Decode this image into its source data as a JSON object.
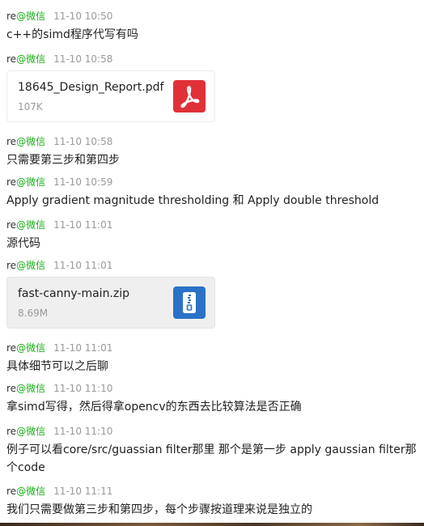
{
  "messages": [
    {
      "sender_name": "re",
      "sender_app": "@微信",
      "time": "11-10 10:50",
      "text": "c++的simd程序代写有吗"
    },
    {
      "sender_name": "re",
      "sender_app": "@微信",
      "time": "11-10 10:58",
      "file": {
        "name": "18645_Design_Report.pdf",
        "size": "107K",
        "icon": "pdf-icon",
        "color": "#e03137"
      }
    },
    {
      "sender_name": "re",
      "sender_app": "@微信",
      "time": "11-10 10:58",
      "text": "只需要第三步和第四步"
    },
    {
      "sender_name": "re",
      "sender_app": "@微信",
      "time": "11-10 10:59",
      "text": "Apply gradient magnitude thresholding 和 Apply double threshold"
    },
    {
      "sender_name": "re",
      "sender_app": "@微信",
      "time": "11-10 11:01",
      "text": "源代码"
    },
    {
      "sender_name": "re",
      "sender_app": "@微信",
      "time": "11-10 11:01",
      "file": {
        "name": "fast-canny-main.zip",
        "size": "8.69M",
        "icon": "zip-icon",
        "color": "#2a72c6"
      }
    },
    {
      "sender_name": "re",
      "sender_app": "@微信",
      "time": "11-10 11:01",
      "text": "具体细节可以之后聊"
    },
    {
      "sender_name": "re",
      "sender_app": "@微信",
      "time": "11-10 11:10",
      "text": "拿simd写得，然后得拿opencv的东西去比较算法是否正确"
    },
    {
      "sender_name": "re",
      "sender_app": "@微信",
      "time": "11-10 11:10",
      "text": "例子可以看core/src/guassian filter那里 那个是第一步 apply gaussian filter那个code"
    },
    {
      "sender_name": "re",
      "sender_app": "@微信",
      "time": "11-10 11:11",
      "text": "我们只需要做第三步和第四步，每个步骤按道理来说是独立的"
    }
  ],
  "colors": {
    "sender_app": "#1aad19",
    "time": "#9a9a9a",
    "text": "#1f1f1f"
  }
}
